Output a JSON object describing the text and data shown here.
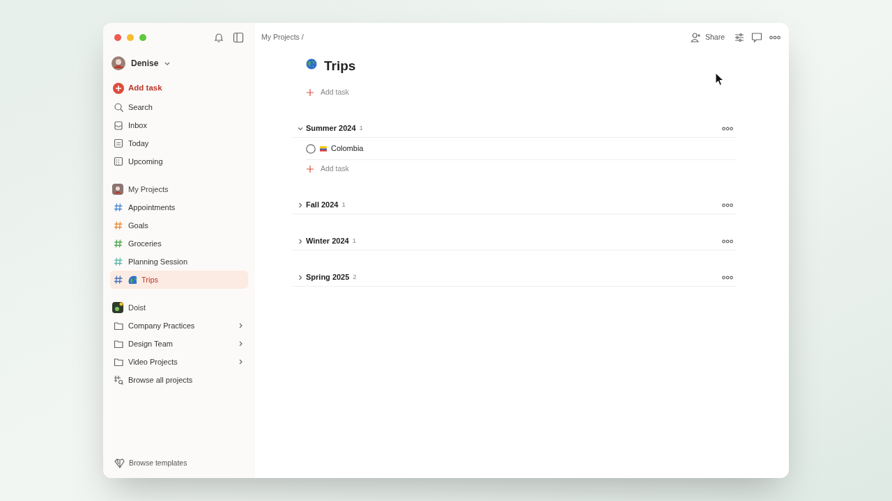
{
  "sidebar": {
    "user": {
      "name": "Denise"
    },
    "add_task": "Add task",
    "nav": [
      {
        "label": "Search",
        "kind": "search"
      },
      {
        "label": "Inbox",
        "kind": "inbox"
      },
      {
        "label": "Today",
        "kind": "today"
      },
      {
        "label": "Upcoming",
        "kind": "upcoming"
      }
    ],
    "projects_header": "My Projects",
    "projects": [
      {
        "label": "Appointments",
        "color": "#4a86d4",
        "selected": false,
        "globe": false
      },
      {
        "label": "Goals",
        "color": "#e58a3c",
        "selected": false,
        "globe": false
      },
      {
        "label": "Groceries",
        "color": "#4aa64e",
        "selected": false,
        "globe": false
      },
      {
        "label": "Planning Session",
        "color": "#5db5ad",
        "selected": false,
        "globe": false
      },
      {
        "label": "Trips",
        "color": "#3f6fc0",
        "selected": true,
        "globe": true
      }
    ],
    "workspace": "Doist",
    "workspace_items": [
      {
        "label": "Company Practices",
        "kind": "folder"
      },
      {
        "label": "Design Team",
        "kind": "folder"
      },
      {
        "label": "Video Projects",
        "kind": "folder"
      },
      {
        "label": "Browse all projects",
        "kind": "browse"
      }
    ],
    "footer": "Browse templates"
  },
  "main": {
    "breadcrumb": "My Projects /",
    "share": "Share",
    "title": "Trips",
    "add_task": "Add task",
    "sections": [
      {
        "title": "Summer 2024",
        "count": "1",
        "expanded": true,
        "tasks": [
          {
            "title": "Colombia",
            "checked": false
          }
        ],
        "add_task": "Add task"
      },
      {
        "title": "Fall 2024",
        "count": "1",
        "expanded": false
      },
      {
        "title": "Winter 2024",
        "count": "1",
        "expanded": false
      },
      {
        "title": "Spring 2025",
        "count": "2",
        "expanded": false
      }
    ]
  }
}
